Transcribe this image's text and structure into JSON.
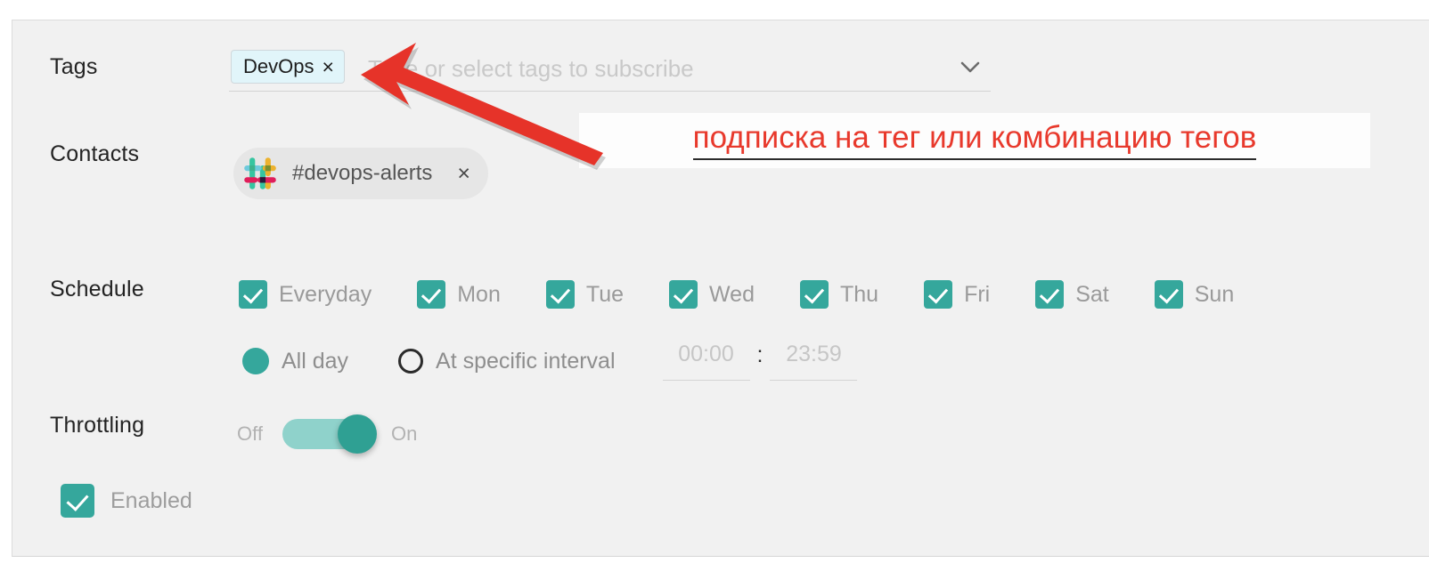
{
  "form": {
    "tags": {
      "label": "Tags",
      "chip": {
        "text": "DevOps",
        "remove": "×"
      },
      "placeholder": "Type or select tags to subscribe",
      "chevron_icon": "chevron-down-icon"
    },
    "contacts": {
      "label": "Contacts",
      "pill": {
        "icon": "slack-icon",
        "text": "#devops-alerts",
        "remove": "×"
      }
    },
    "schedule": {
      "label": "Schedule",
      "days": [
        {
          "label": "Everyday",
          "checked": true
        },
        {
          "label": "Mon",
          "checked": true
        },
        {
          "label": "Tue",
          "checked": true
        },
        {
          "label": "Wed",
          "checked": true
        },
        {
          "label": "Thu",
          "checked": true
        },
        {
          "label": "Fri",
          "checked": true
        },
        {
          "label": "Sat",
          "checked": true
        },
        {
          "label": "Sun",
          "checked": true
        }
      ],
      "mode": {
        "all_day": {
          "label": "All day",
          "selected": true
        },
        "interval": {
          "label": "At specific interval",
          "selected": false
        }
      },
      "time_from": "00:00",
      "time_separator": ":",
      "time_to": "23:59"
    },
    "throttling": {
      "label": "Throttling",
      "off_label": "Off",
      "on_label": "On",
      "state": "On"
    },
    "enabled": {
      "label": "Enabled",
      "checked": true
    }
  },
  "annotation": {
    "text": "подписка на тег или комбинацию тегов",
    "arrow_icon": "arrow-up-left-icon",
    "color": "#e8392c"
  },
  "colors": {
    "accent_teal": "#35a79c",
    "toggle_track": "#8fd2cb",
    "chip_bg": "#e1f5fa",
    "pill_bg": "#e6e6e6",
    "panel_bg": "#f1f1f1",
    "annotation_red": "#e8392c"
  }
}
